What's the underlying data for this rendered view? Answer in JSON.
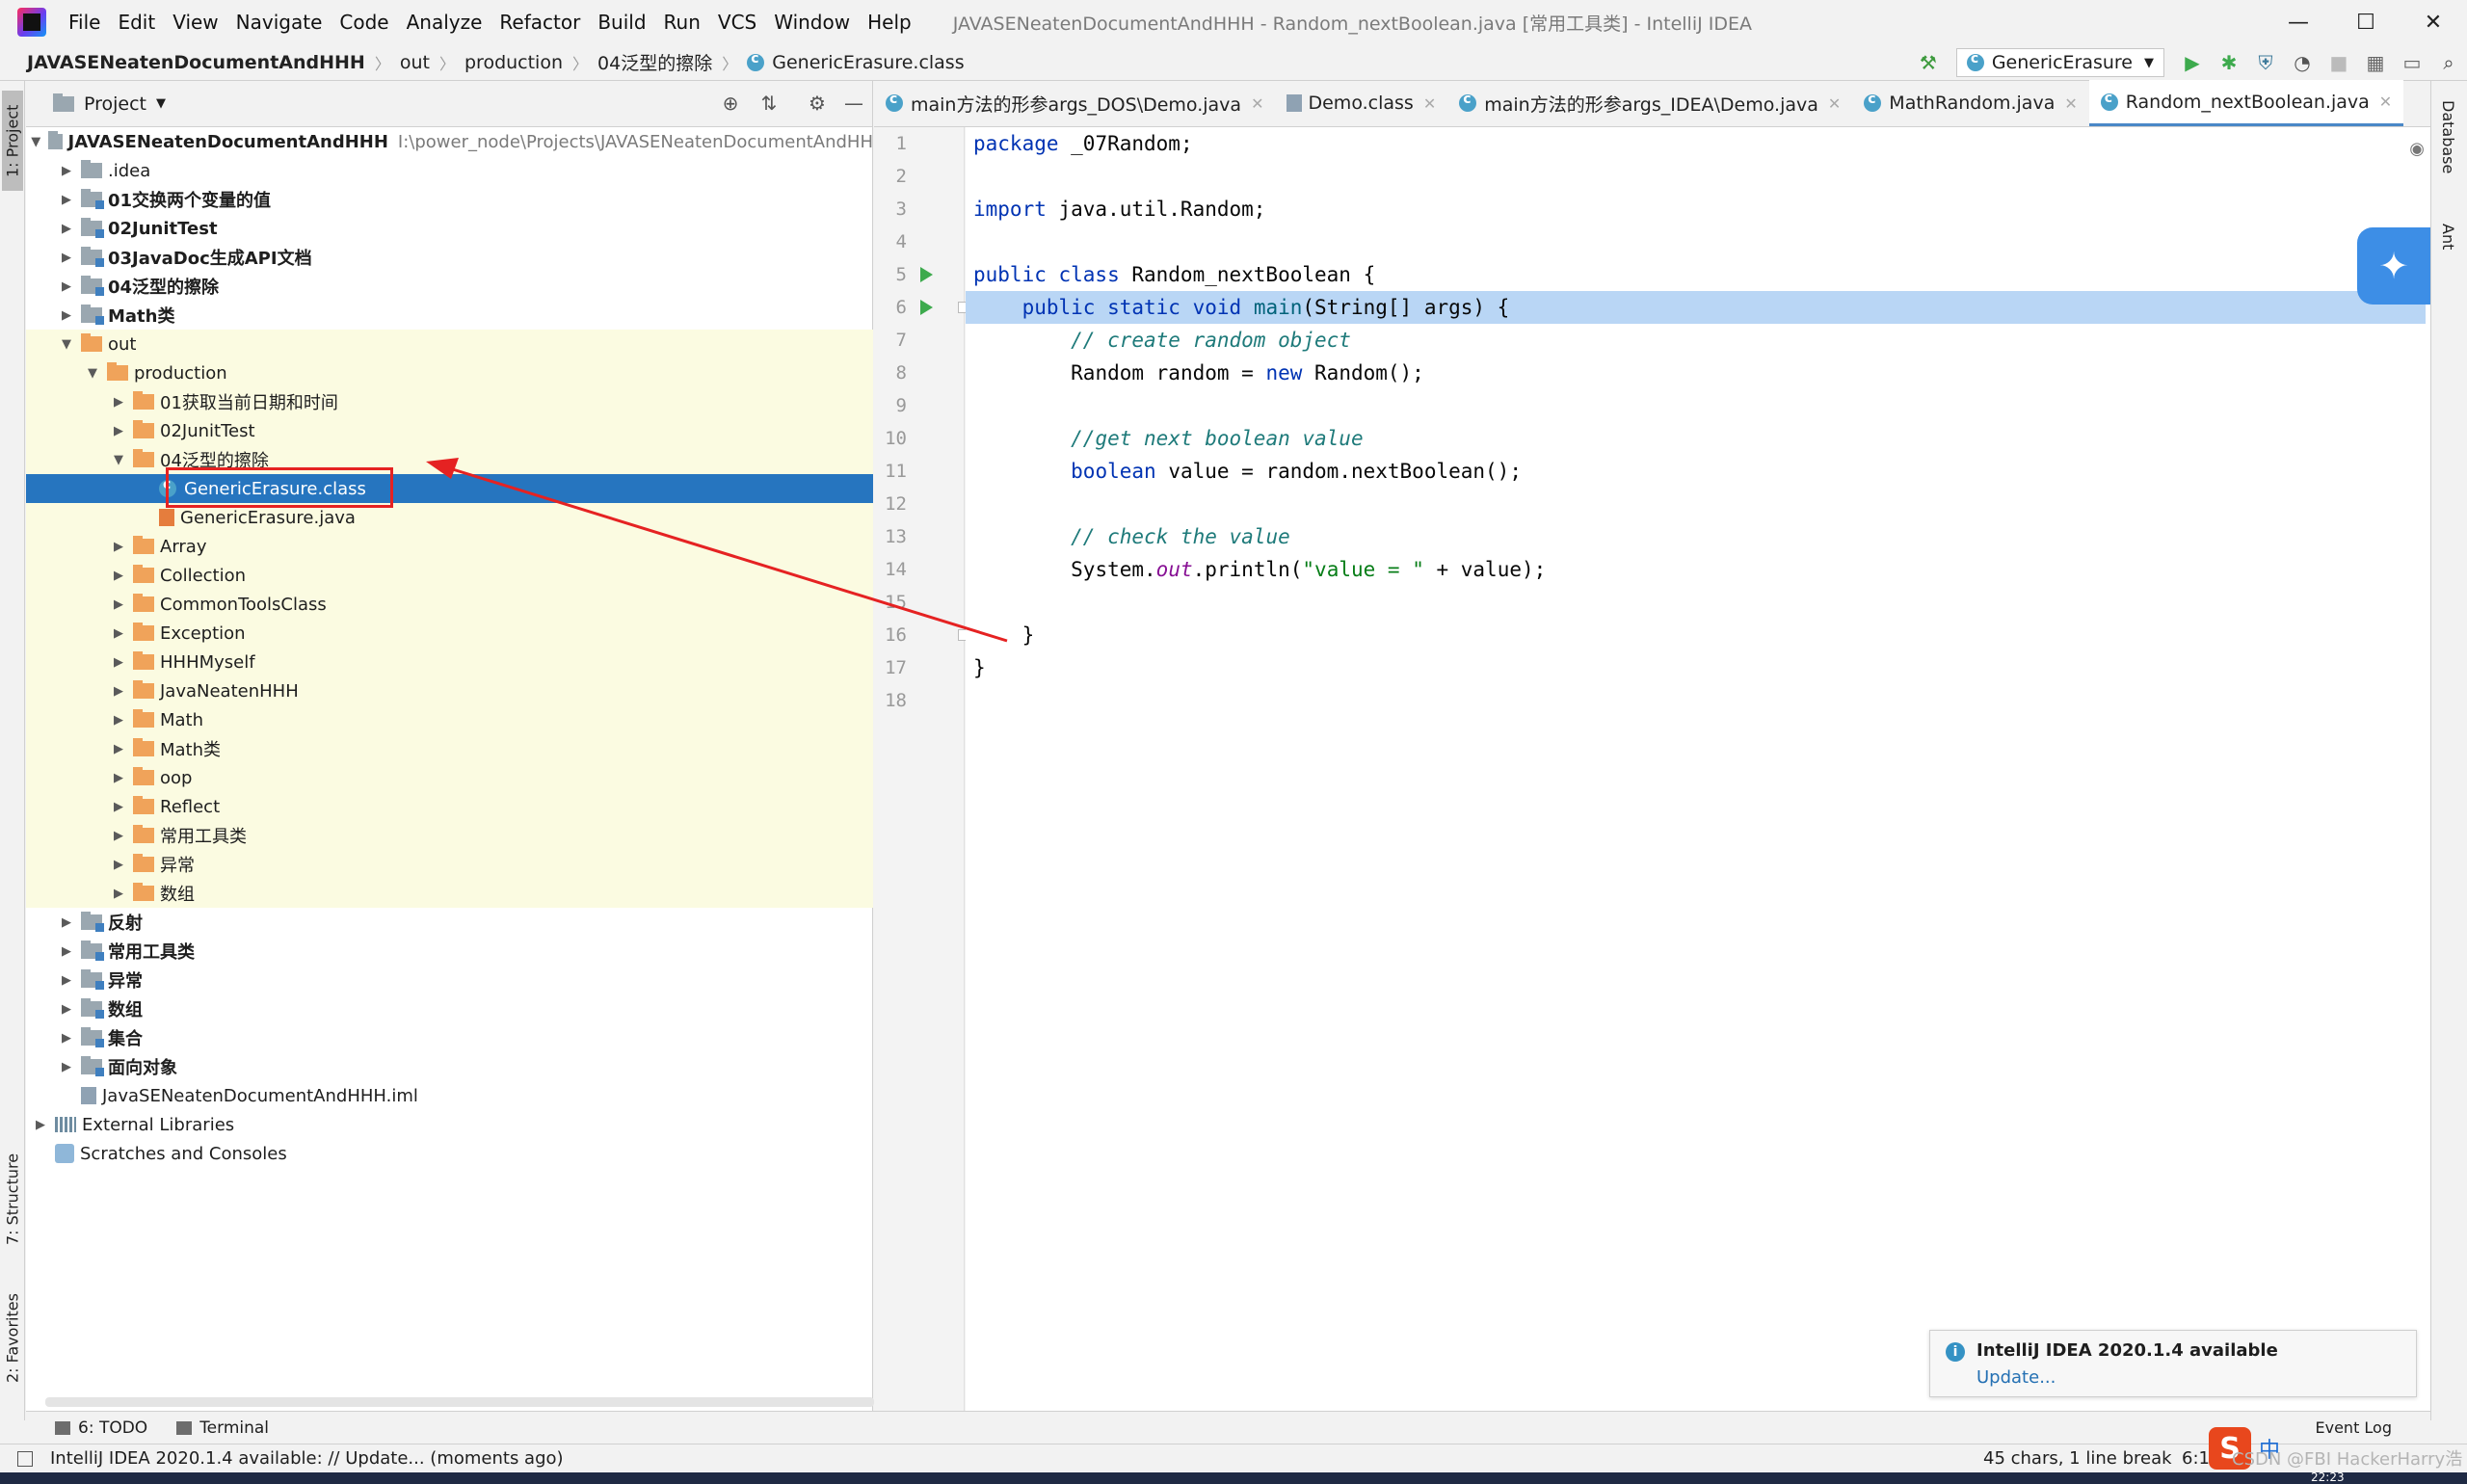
{
  "menu": [
    "File",
    "Edit",
    "View",
    "Navigate",
    "Code",
    "Analyze",
    "Refactor",
    "Build",
    "Run",
    "VCS",
    "Window",
    "Help"
  ],
  "window_title": "JAVASENeatenDocumentAndHHH - Random_nextBoolean.java [常用工具类] - IntelliJ IDEA",
  "breadcrumb": [
    "JAVASENeatenDocumentAndHHH",
    "out",
    "production",
    "04泛型的擦除",
    "GenericErasure.class"
  ],
  "run_config": "GenericErasure",
  "project_panel": {
    "title": "Project",
    "root_path": "I:\\power_node\\Projects\\JAVASENeatenDocumentAndHH",
    "tree": [
      {
        "label": "JAVASENeatenDocumentAndHHH",
        "depth": 0,
        "arrow": "▼",
        "icon": "gray",
        "bold": true,
        "bg": ""
      },
      {
        "label": ".idea",
        "depth": 1,
        "arrow": "▶",
        "icon": "gray",
        "bold": false,
        "bg": ""
      },
      {
        "label": "01交换两个变量的值",
        "depth": 1,
        "arrow": "▶",
        "icon": "gray-mod",
        "bold": true,
        "bg": ""
      },
      {
        "label": "02JunitTest",
        "depth": 1,
        "arrow": "▶",
        "icon": "gray-mod",
        "bold": true,
        "bg": ""
      },
      {
        "label": "03JavaDoc生成API文档",
        "depth": 1,
        "arrow": "▶",
        "icon": "gray-mod",
        "bold": true,
        "bg": ""
      },
      {
        "label": "04泛型的擦除",
        "depth": 1,
        "arrow": "▶",
        "icon": "gray-mod",
        "bold": true,
        "bg": ""
      },
      {
        "label": "Math类",
        "depth": 1,
        "arrow": "▶",
        "icon": "gray-mod",
        "bold": true,
        "bg": ""
      },
      {
        "label": "out",
        "depth": 1,
        "arrow": "▼",
        "icon": "orange",
        "bold": false,
        "bg": "yellow"
      },
      {
        "label": "production",
        "depth": 2,
        "arrow": "▼",
        "icon": "orange",
        "bold": false,
        "bg": "yellow"
      },
      {
        "label": "01获取当前日期和时间",
        "depth": 3,
        "arrow": "▶",
        "icon": "orange",
        "bold": false,
        "bg": "yellow"
      },
      {
        "label": "02JunitTest",
        "depth": 3,
        "arrow": "▶",
        "icon": "orange",
        "bold": false,
        "bg": "yellow"
      },
      {
        "label": "04泛型的擦除",
        "depth": 3,
        "arrow": "▼",
        "icon": "orange",
        "bold": false,
        "bg": "yellow"
      },
      {
        "label": "GenericErasure.class",
        "depth": 4,
        "arrow": "",
        "icon": "class",
        "bold": false,
        "bg": "selected"
      },
      {
        "label": "GenericErasure.java",
        "depth": 4,
        "arrow": "",
        "icon": "java",
        "bold": false,
        "bg": "yellow"
      },
      {
        "label": "Array",
        "depth": 3,
        "arrow": "▶",
        "icon": "orange",
        "bold": false,
        "bg": "yellow"
      },
      {
        "label": "Collection",
        "depth": 3,
        "arrow": "▶",
        "icon": "orange",
        "bold": false,
        "bg": "yellow"
      },
      {
        "label": "CommonToolsClass",
        "depth": 3,
        "arrow": "▶",
        "icon": "orange",
        "bold": false,
        "bg": "yellow"
      },
      {
        "label": "Exception",
        "depth": 3,
        "arrow": "▶",
        "icon": "orange",
        "bold": false,
        "bg": "yellow"
      },
      {
        "label": "HHHMyself",
        "depth": 3,
        "arrow": "▶",
        "icon": "orange",
        "bold": false,
        "bg": "yellow"
      },
      {
        "label": "JavaNeatenHHH",
        "depth": 3,
        "arrow": "▶",
        "icon": "orange",
        "bold": false,
        "bg": "yellow"
      },
      {
        "label": "Math",
        "depth": 3,
        "arrow": "▶",
        "icon": "orange",
        "bold": false,
        "bg": "yellow"
      },
      {
        "label": "Math类",
        "depth": 3,
        "arrow": "▶",
        "icon": "orange",
        "bold": false,
        "bg": "yellow"
      },
      {
        "label": "oop",
        "depth": 3,
        "arrow": "▶",
        "icon": "orange",
        "bold": false,
        "bg": "yellow"
      },
      {
        "label": "Reflect",
        "depth": 3,
        "arrow": "▶",
        "icon": "orange",
        "bold": false,
        "bg": "yellow"
      },
      {
        "label": "常用工具类",
        "depth": 3,
        "arrow": "▶",
        "icon": "orange",
        "bold": false,
        "bg": "yellow"
      },
      {
        "label": "异常",
        "depth": 3,
        "arrow": "▶",
        "icon": "orange",
        "bold": false,
        "bg": "yellow"
      },
      {
        "label": "数组",
        "depth": 3,
        "arrow": "▶",
        "icon": "orange",
        "bold": false,
        "bg": "yellow"
      },
      {
        "label": "反射",
        "depth": 1,
        "arrow": "▶",
        "icon": "gray-mod",
        "bold": true,
        "bg": ""
      },
      {
        "label": "常用工具类",
        "depth": 1,
        "arrow": "▶",
        "icon": "gray-mod",
        "bold": true,
        "bg": ""
      },
      {
        "label": "异常",
        "depth": 1,
        "arrow": "▶",
        "icon": "gray-mod",
        "bold": true,
        "bg": ""
      },
      {
        "label": "数组",
        "depth": 1,
        "arrow": "▶",
        "icon": "gray-mod",
        "bold": true,
        "bg": ""
      },
      {
        "label": "集合",
        "depth": 1,
        "arrow": "▶",
        "icon": "gray-mod",
        "bold": true,
        "bg": ""
      },
      {
        "label": "面向对象",
        "depth": 1,
        "arrow": "▶",
        "icon": "gray-mod",
        "bold": true,
        "bg": ""
      },
      {
        "label": "JavaSENeatenDocumentAndHHH.iml",
        "depth": 1,
        "arrow": "",
        "icon": "iml",
        "bold": false,
        "bg": ""
      },
      {
        "label": "External Libraries",
        "depth": 0,
        "arrow": "▶",
        "icon": "lib",
        "bold": false,
        "bg": ""
      },
      {
        "label": "Scratches and Consoles",
        "depth": 0,
        "arrow": "",
        "icon": "scratch",
        "bold": false,
        "bg": ""
      }
    ]
  },
  "editor_tabs": [
    {
      "label": "main方法的形参args_DOS\\Demo.java",
      "active": false
    },
    {
      "label": "Demo.class",
      "active": false
    },
    {
      "label": "main方法的形参args_IDEA\\Demo.java",
      "active": false
    },
    {
      "label": "MathRandom.java",
      "active": false
    },
    {
      "label": "Random_nextBoolean.java",
      "active": true
    }
  ],
  "line_numbers": [
    "1",
    "2",
    "3",
    "4",
    "5",
    "6",
    "7",
    "8",
    "9",
    "10",
    "11",
    "12",
    "13",
    "14",
    "15",
    "16",
    "17",
    "18"
  ],
  "code": {
    "l1_kw": "package",
    "l1_rest": " _07Random;",
    "l3_kw": "import",
    "l3_rest": " java.util.Random;",
    "l5_kw": "public class",
    "l5_rest": " Random_nextBoolean {",
    "l6_kw": "public static void",
    "l6_fn": "main",
    "l6_rest": "(String[] args) {",
    "l7_cm": "// create random object",
    "l8_a": "Random random = ",
    "l8_kw": "new",
    "l8_b": " Random();",
    "l10_cm": "//get next boolean value",
    "l11_kw": "boolean",
    "l11_rest": " value = random.nextBoolean();",
    "l13_cm": "// check the value",
    "l14_a": "System.",
    "l14_sf": "out",
    "l14_b": ".println(",
    "l14_st": "\"value = \"",
    "l14_c": " + value);",
    "l16": "}",
    "l17": "}"
  },
  "left_strip": {
    "project": "1: Project",
    "structure": "7: Structure",
    "favorites": "2: Favorites"
  },
  "right_strip": {
    "database": "Database",
    "ant": "Ant"
  },
  "notification": {
    "title": "IntelliJ IDEA 2020.1.4 available",
    "link": "Update..."
  },
  "bottom_tools": {
    "todo": "6: TODO",
    "terminal": "Terminal",
    "event_log": "Event Log"
  },
  "status": {
    "message": "IntelliJ IDEA 2020.1.4 available: // Update... (moments ago)",
    "chars": "45 chars, 1 line break",
    "pos": "6:1"
  },
  "ime": {
    "zh": "中"
  },
  "watermark": "CSDN @FBI HackerHarry浩",
  "clock": "22:23",
  "colors": {
    "selection": "#2675bf",
    "annotation": "#e52222",
    "caret_line": "#b9d6f5"
  }
}
